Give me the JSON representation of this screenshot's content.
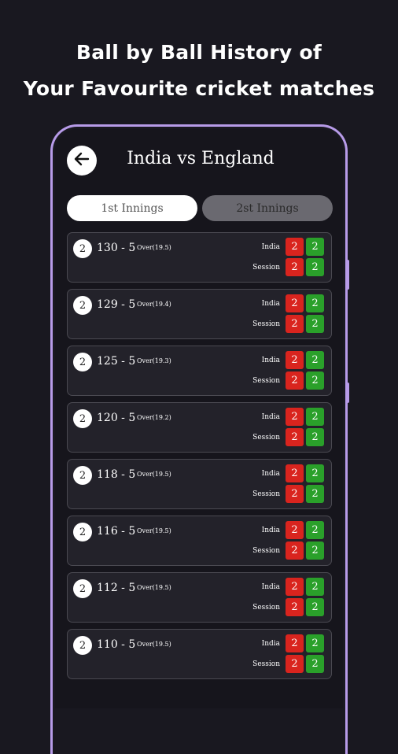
{
  "header": {
    "line1": "Ball by Ball History of",
    "line2": "Your Favourite cricket matches"
  },
  "app": {
    "title": "India vs England",
    "tabs": [
      "1st Innings",
      "2st Innings"
    ],
    "colors": {
      "frame": "#b79be8",
      "red": "#d9241e",
      "green": "#2aa02a"
    }
  },
  "rows": [
    {
      "ball": "2",
      "score": "130 - 5",
      "over": "Over(19.5)",
      "label1": "India",
      "label2": "Session",
      "v1": "2",
      "v2": "2",
      "v3": "2",
      "v4": "2"
    },
    {
      "ball": "2",
      "score": "129 - 5",
      "over": "Over(19.4)",
      "label1": "India",
      "label2": "Session",
      "v1": "2",
      "v2": "2",
      "v3": "2",
      "v4": "2"
    },
    {
      "ball": "2",
      "score": "125 - 5",
      "over": "Over(19.3)",
      "label1": "India",
      "label2": "Session",
      "v1": "2",
      "v2": "2",
      "v3": "2",
      "v4": "2"
    },
    {
      "ball": "2",
      "score": "120 - 5",
      "over": "Over(19.2)",
      "label1": "India",
      "label2": "Session",
      "v1": "2",
      "v2": "2",
      "v3": "2",
      "v4": "2"
    },
    {
      "ball": "2",
      "score": "118 - 5",
      "over": "Over(19.5)",
      "label1": "India",
      "label2": "Session",
      "v1": "2",
      "v2": "2",
      "v3": "2",
      "v4": "2"
    },
    {
      "ball": "2",
      "score": "116 - 5",
      "over": "Over(19.5)",
      "label1": "India",
      "label2": "Session",
      "v1": "2",
      "v2": "2",
      "v3": "2",
      "v4": "2"
    },
    {
      "ball": "2",
      "score": "112 - 5",
      "over": "Over(19.5)",
      "label1": "India",
      "label2": "Session",
      "v1": "2",
      "v2": "2",
      "v3": "2",
      "v4": "2"
    },
    {
      "ball": "2",
      "score": "110 - 5",
      "over": "Over(19.5)",
      "label1": "India",
      "label2": "Session",
      "v1": "2",
      "v2": "2",
      "v3": "2",
      "v4": "2"
    }
  ]
}
